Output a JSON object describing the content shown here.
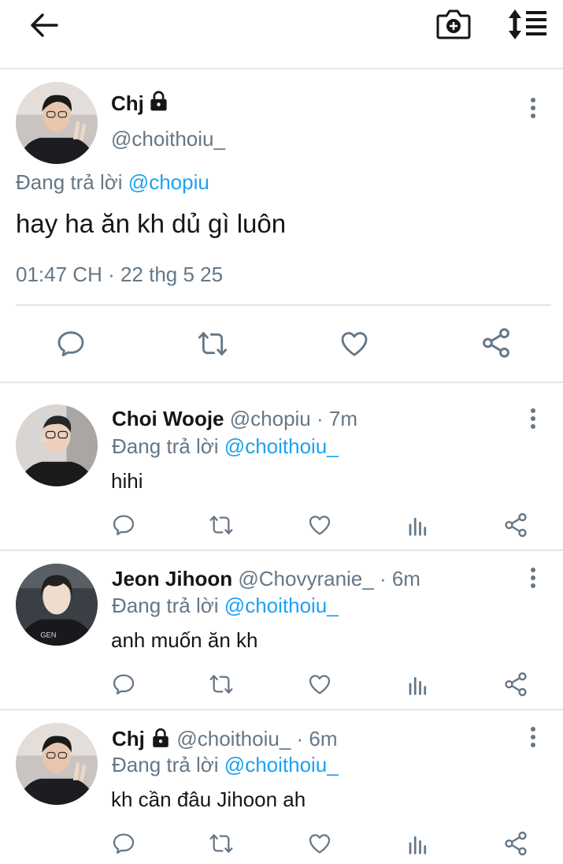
{
  "topbar": {
    "back_icon": "arrow-left-icon",
    "camera_icon": "camera-plus-icon",
    "sort_icon": "sort-list-icon"
  },
  "main_tweet": {
    "name": "Chj",
    "lock_icon": "lock-icon",
    "handle": "@choithoiu_",
    "reply_prefix": "Đang trả lời",
    "reply_to": "@chopiu",
    "text": "hay ha ăn kh dủ gì luôn",
    "timestamp": "01:47 CH · 22 thg 5 25",
    "actions": [
      "reply-icon",
      "retweet-icon",
      "like-icon",
      "share-icon"
    ]
  },
  "replies": [
    {
      "name": "Choi Wooje",
      "handle": "@chopiu",
      "time": "· 7m",
      "reply_prefix": "Đang trả lời",
      "reply_to": "@choithoiu_",
      "text": "hihi"
    },
    {
      "name": "Jeon Jihoon",
      "handle": "@Chovyranie_",
      "time": "· 6m",
      "reply_prefix": "Đang trả lời",
      "reply_to": "@choithoiu_",
      "text": "anh muốn ăn kh"
    },
    {
      "name": "Chj",
      "handle": "@choithoiu_",
      "time": "· 6m",
      "reply_prefix": "Đang trả lời",
      "reply_to": "@choithoiu_",
      "text": "kh cần đâu Jihoon ah"
    }
  ],
  "colors": {
    "link": "#1da1f2",
    "secondary_text": "#657786",
    "icon": "#657786",
    "divider": "#e1e6ea"
  }
}
